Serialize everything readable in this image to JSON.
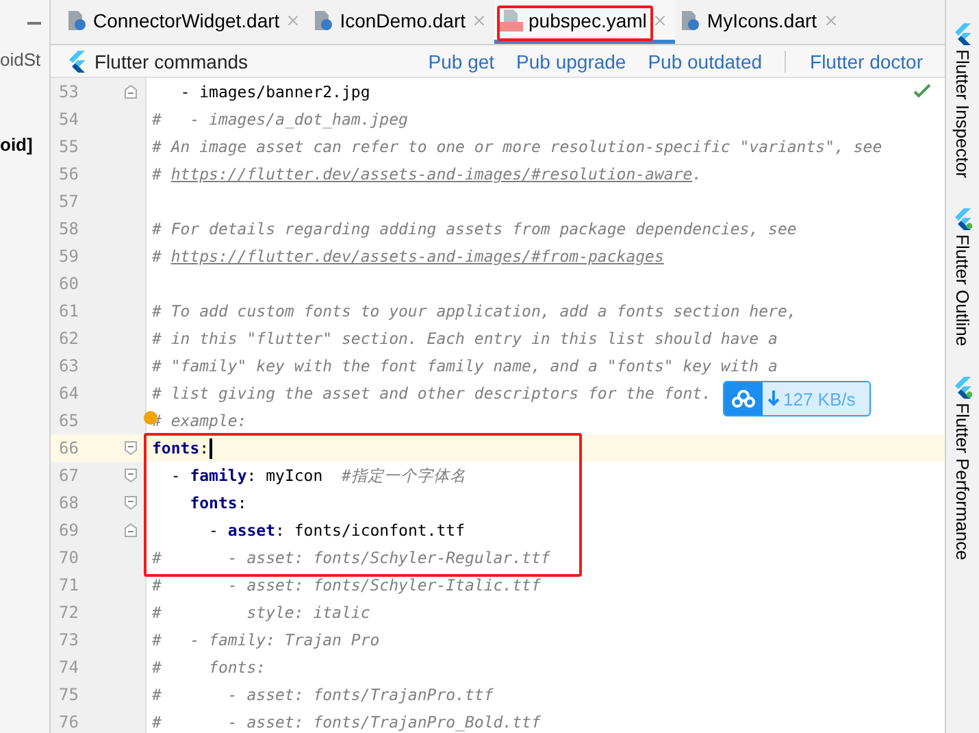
{
  "left_panel": {
    "texts": [
      "oidSt",
      "oid]"
    ]
  },
  "tabs": [
    {
      "label": "ConnectorWidget.dart",
      "kind": "dart",
      "selected": false
    },
    {
      "label": "IconDemo.dart",
      "kind": "dart",
      "selected": false
    },
    {
      "label": "pubspec.yaml",
      "kind": "yaml",
      "selected": true
    },
    {
      "label": "MyIcons.dart",
      "kind": "dart",
      "selected": false
    }
  ],
  "toolbar": {
    "title": "Flutter commands",
    "actions": [
      "Pub get",
      "Pub upgrade",
      "Pub outdated",
      "Flutter doctor"
    ]
  },
  "editor": {
    "lines": [
      {
        "number": "53",
        "current": false,
        "fold_end": true,
        "segments": [
          {
            "kind": "plain",
            "text": "   - images/banner2.jpg"
          }
        ]
      },
      {
        "number": "54",
        "current": false,
        "segments": [
          {
            "kind": "comment",
            "text": "#   - images/a_dot_ham.jpeg"
          }
        ]
      },
      {
        "number": "55",
        "current": false,
        "segments": [
          {
            "kind": "comment",
            "text": "# An image asset can refer to one or more resolution-specific \"variants\", see"
          }
        ]
      },
      {
        "number": "56",
        "current": false,
        "segments": [
          {
            "kind": "comment",
            "text": "# "
          },
          {
            "kind": "link",
            "text": "https://flutter.dev/assets-and-images/#resolution-aware"
          },
          {
            "kind": "comment",
            "text": "."
          }
        ]
      },
      {
        "number": "57",
        "current": false
      },
      {
        "number": "58",
        "current": false,
        "segments": [
          {
            "kind": "comment",
            "text": "# For details regarding adding assets from package dependencies, see"
          }
        ]
      },
      {
        "number": "59",
        "current": false,
        "segments": [
          {
            "kind": "comment",
            "text": "# "
          },
          {
            "kind": "link",
            "text": "https://flutter.dev/assets-and-images/#from-packages"
          }
        ]
      },
      {
        "number": "60",
        "current": false
      },
      {
        "number": "61",
        "current": false,
        "segments": [
          {
            "kind": "comment",
            "text": "# To add custom fonts to your application, add a fonts section here,"
          }
        ]
      },
      {
        "number": "62",
        "current": false,
        "segments": [
          {
            "kind": "comment",
            "text": "# in this \"flutter\" section. Each entry in this list should have a"
          }
        ]
      },
      {
        "number": "63",
        "current": false,
        "segments": [
          {
            "kind": "comment",
            "text": "# \"family\" key with the font family name, and a \"fonts\" key with a"
          }
        ]
      },
      {
        "number": "64",
        "current": false,
        "segments": [
          {
            "kind": "comment",
            "text": "# list giving the asset and other descriptors for the font."
          }
        ]
      },
      {
        "number": "65",
        "current": false,
        "bulb": true,
        "segments": [
          {
            "kind": "comment",
            "text": "# example:"
          }
        ]
      },
      {
        "number": "66",
        "current": true,
        "fold_start": true,
        "segments": [
          {
            "kind": "key",
            "text": "fonts"
          },
          {
            "kind": "plain",
            "text": ":"
          }
        ]
      },
      {
        "number": "67",
        "current": false,
        "fold_start": true,
        "segments": [
          {
            "kind": "plain",
            "text": "  - "
          },
          {
            "kind": "key",
            "text": "family"
          },
          {
            "kind": "plain",
            "text": ": myIcon  "
          },
          {
            "kind": "comment",
            "text": "#指定一个字体名"
          }
        ]
      },
      {
        "number": "68",
        "current": false,
        "fold_start": true,
        "segments": [
          {
            "kind": "key",
            "text": "    fonts"
          },
          {
            "kind": "plain",
            "text": ":"
          }
        ]
      },
      {
        "number": "69",
        "current": false,
        "fold_end": true,
        "segments": [
          {
            "kind": "plain",
            "text": "      - "
          },
          {
            "kind": "key",
            "text": "asset"
          },
          {
            "kind": "plain",
            "text": ": fonts/iconfont.ttf"
          }
        ]
      },
      {
        "number": "70",
        "current": false,
        "segments": [
          {
            "kind": "comment",
            "text": "#       - asset: fonts/Schyler-Regular.ttf"
          }
        ]
      },
      {
        "number": "71",
        "current": false,
        "segments": [
          {
            "kind": "comment",
            "text": "#       - asset: fonts/Schyler-Italic.ttf"
          }
        ]
      },
      {
        "number": "72",
        "current": false,
        "segments": [
          {
            "kind": "comment",
            "text": "#         style: italic"
          }
        ]
      },
      {
        "number": "73",
        "current": false,
        "segments": [
          {
            "kind": "comment",
            "text": "#   - family: Trajan Pro"
          }
        ]
      },
      {
        "number": "74",
        "current": false,
        "segments": [
          {
            "kind": "comment",
            "text": "#     fonts:"
          }
        ]
      },
      {
        "number": "75",
        "current": false,
        "segments": [
          {
            "kind": "comment",
            "text": "#       - asset: fonts/TrajanPro.ttf"
          }
        ]
      },
      {
        "number": "76",
        "current": false,
        "segments": [
          {
            "kind": "comment",
            "text": "#       - asset: fonts/TrajanPro_Bold.ttf"
          }
        ]
      }
    ]
  },
  "download_badge": {
    "speed": "127 KB/s"
  },
  "side_tools": [
    "Flutter Inspector",
    "Flutter Outline",
    "Flutter Performance"
  ]
}
